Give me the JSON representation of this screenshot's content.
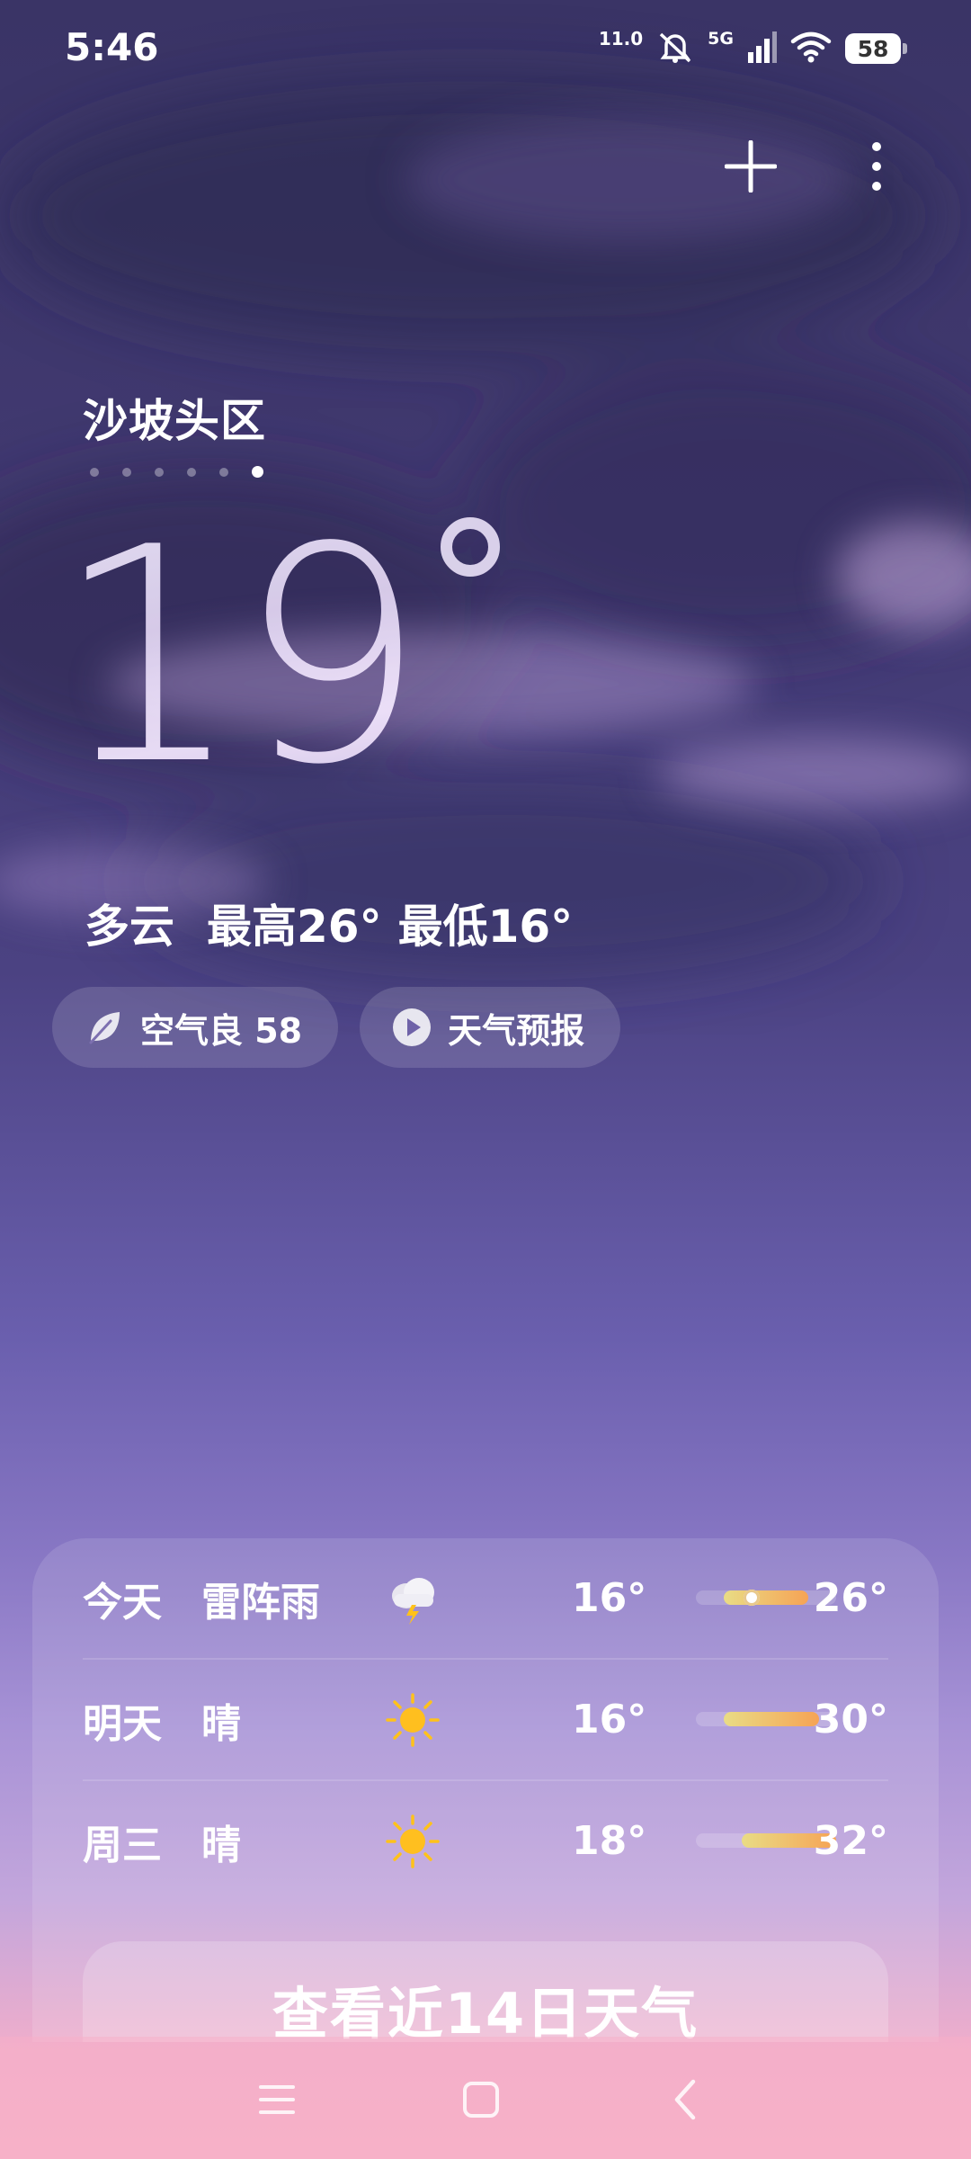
{
  "status_bar": {
    "time": "5:46",
    "speed": "11.0",
    "network": "5G",
    "battery": "58",
    "icons": [
      "mute-bell-icon",
      "signal-icon",
      "wifi-icon",
      "battery-icon"
    ]
  },
  "header": {
    "add_icon": "plus-icon",
    "more_icon": "more-vertical-icon"
  },
  "location": {
    "name": "沙坡头区",
    "page_count": 6,
    "active_index": 5
  },
  "current": {
    "temp": "19",
    "condition": "多云",
    "high": "最高26°",
    "low": "最低16°"
  },
  "chips": {
    "air": "空气良 58",
    "forecast": "天气预报"
  },
  "daily": [
    {
      "day": "今天",
      "condition": "雷阵雨",
      "icon": "thunderstorm-icon",
      "low": "16°",
      "high": "26°",
      "bar_start": 0.2,
      "bar_end": 0.8,
      "now": 0.4
    },
    {
      "day": "明天",
      "condition": "晴",
      "icon": "sun-icon",
      "low": "16°",
      "high": "30°",
      "bar_start": 0.2,
      "bar_end": 0.88
    },
    {
      "day": "周三",
      "condition": "晴",
      "icon": "sun-icon",
      "low": "18°",
      "high": "32°",
      "bar_start": 0.33,
      "bar_end": 1.0
    }
  ],
  "forecast_button": "查看近14日天气",
  "colors": {
    "bar_start": "#e9dc85",
    "bar_end": "#f6a355",
    "sun": "#ffc21a"
  }
}
